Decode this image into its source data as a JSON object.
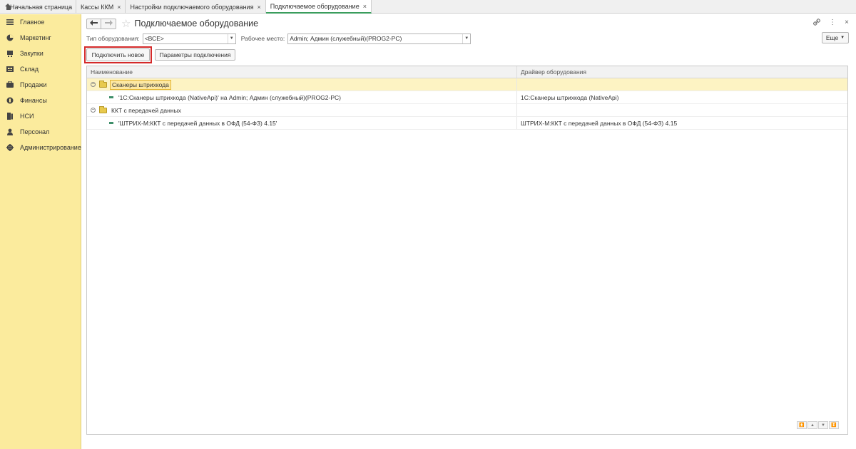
{
  "tabs": [
    {
      "label": "Начальная страница",
      "closable": false,
      "active": false
    },
    {
      "label": "Кассы ККМ",
      "closable": true,
      "active": false
    },
    {
      "label": "Настройки подключаемого оборудования",
      "closable": true,
      "active": false
    },
    {
      "label": "Подключаемое оборудование",
      "closable": true,
      "active": true
    }
  ],
  "tab_close_glyph": "×",
  "sidebar": {
    "items": [
      {
        "label": "Главное",
        "icon": "menu-icon"
      },
      {
        "label": "Маркетинг",
        "icon": "pie-chart-icon"
      },
      {
        "label": "Закупки",
        "icon": "cart-icon"
      },
      {
        "label": "Склад",
        "icon": "warehouse-icon"
      },
      {
        "label": "Продажи",
        "icon": "sales-icon"
      },
      {
        "label": "Финансы",
        "icon": "money-icon"
      },
      {
        "label": "НСИ",
        "icon": "book-icon"
      },
      {
        "label": "Персонал",
        "icon": "person-icon"
      },
      {
        "label": "Администрирование",
        "icon": "gear-icon"
      }
    ]
  },
  "header": {
    "title": "Подключаемое оборудование",
    "back_glyph": "🡐",
    "forward_glyph": "🡒",
    "star_glyph": "☆",
    "link_glyph": "🔗",
    "menu_glyph": "⋮",
    "close_glyph": "×"
  },
  "filters": {
    "equipment_type_label": "Тип оборудования:",
    "equipment_type_value": "<ВСЕ>",
    "workplace_label": "Рабочее место:",
    "workplace_value": "Admin; Админ (служебный)(PROG2-PC)"
  },
  "more_button": "Еще",
  "actions": {
    "connect_new": "Подключить новое",
    "connection_params": "Параметры подключения"
  },
  "table": {
    "columns": [
      "Наименование",
      "Драйвер оборудования"
    ],
    "groups": [
      {
        "label": "Сканеры штрихкода",
        "selected": true,
        "items": [
          {
            "name": "'1С:Сканеры штрихкода (NativeApi)' на Admin; Админ (служебный)(PROG2-PC)",
            "driver": "1С:Сканеры штрихкода (NativeApi)"
          }
        ]
      },
      {
        "label": "ККТ с передачей данных",
        "selected": false,
        "items": [
          {
            "name": "'ШТРИХ-М:ККТ с передачей данных в ОФД (54-ФЗ) 4.15'",
            "driver": "ШТРИХ-М:ККТ с передачей данных в ОФД (54-ФЗ) 4.15"
          }
        ]
      }
    ]
  },
  "colors": {
    "sidebar_bg": "#fbeb9d",
    "highlight_border": "#d42a2a",
    "active_tab_underline": "#3a9d5d",
    "selected_row": "#fdf3c3"
  }
}
